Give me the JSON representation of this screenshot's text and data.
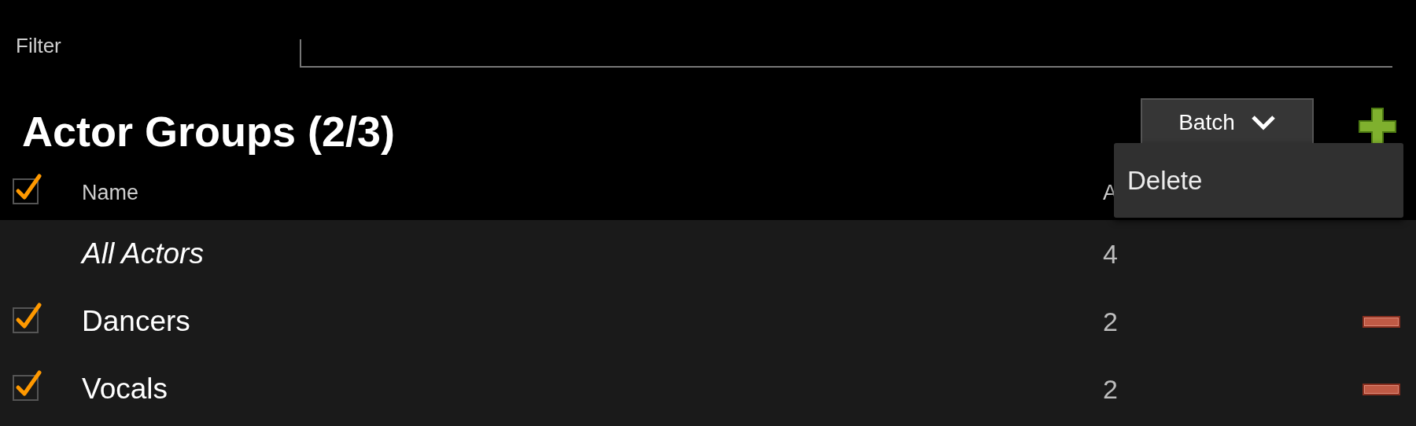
{
  "filter": {
    "label": "Filter"
  },
  "title": "Actor Groups (2/3)",
  "batch_button": {
    "label": "Batch",
    "expanded": true
  },
  "batch_menu": {
    "items": [
      {
        "label": "Delete"
      }
    ]
  },
  "table": {
    "select_all": {
      "checked": true
    },
    "columns": [
      "Name",
      "A"
    ],
    "rows": [
      {
        "name": "All Actors",
        "count": "4",
        "kind": "builtin"
      },
      {
        "name": "Dancers",
        "count": "2",
        "kind": "group",
        "checked": true
      },
      {
        "name": "Vocals",
        "count": "2",
        "kind": "group",
        "checked": true
      }
    ]
  }
}
